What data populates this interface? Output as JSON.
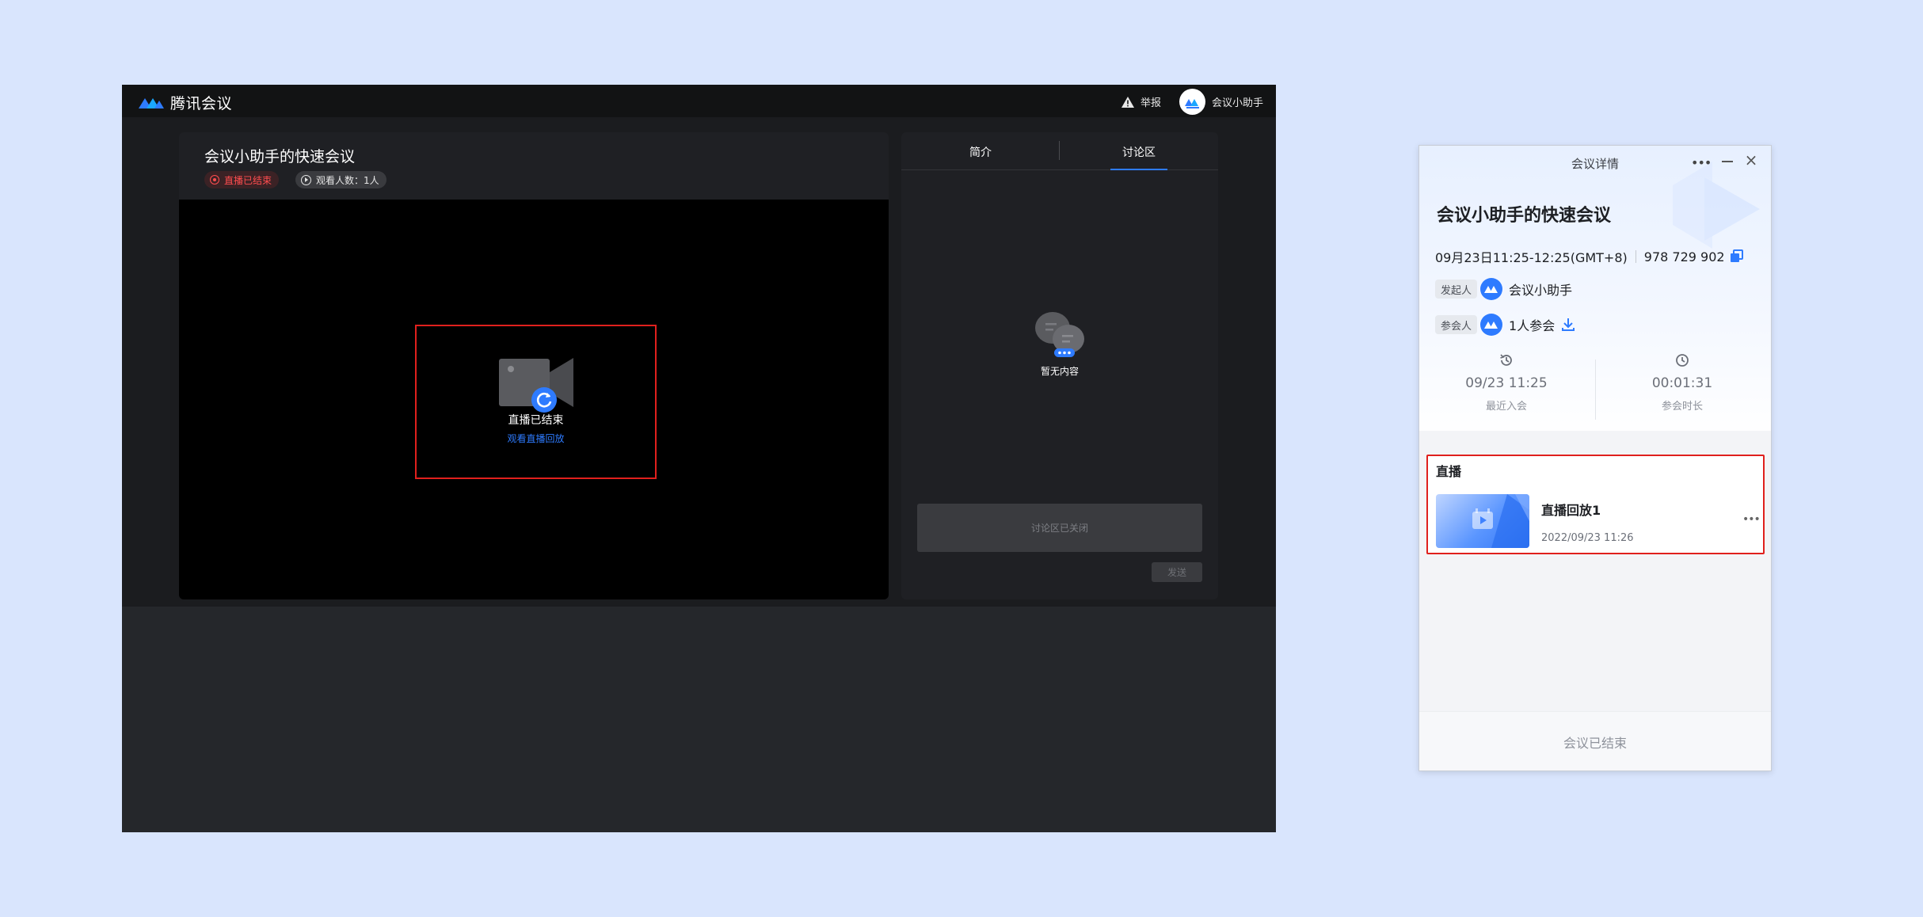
{
  "live_page": {
    "brand": "腾讯会议",
    "report_label": "举报",
    "user_name": "会议小助手",
    "meeting_title": "会议小助手的快速会议",
    "status_badge": "直播已结束",
    "viewers": "观看人数：1人",
    "ended_text": "直播已结束",
    "replay_link": "观看直播回放",
    "tabs": [
      "简介",
      "讨论区"
    ],
    "active_tab": "讨论区",
    "empty_text": "暂无内容",
    "chat_closed_placeholder": "讨论区已关闭",
    "send_label": "发送",
    "accent": "#2e7bff",
    "alert_red": "#e0201d"
  },
  "details": {
    "window_title": "会议详情",
    "meeting_title": "会议小助手的快速会议",
    "time_range": "09月23日11:25-12:25(GMT+8)",
    "meeting_id": "978 729 902",
    "organizer_tag": "发起人",
    "organizer_name": "会议小助手",
    "participants_tag": "参会人",
    "participants_count": "1人参会",
    "stats": [
      {
        "value": "09/23 11:25",
        "label": "最近入会",
        "icon": "history-icon"
      },
      {
        "value": "00:01:31",
        "label": "参会时长",
        "icon": "clock-icon"
      }
    ],
    "live_section_heading": "直播",
    "replay_name": "直播回放1",
    "replay_date": "2022/09/23 11:26",
    "footer_status": "会议已结束"
  }
}
